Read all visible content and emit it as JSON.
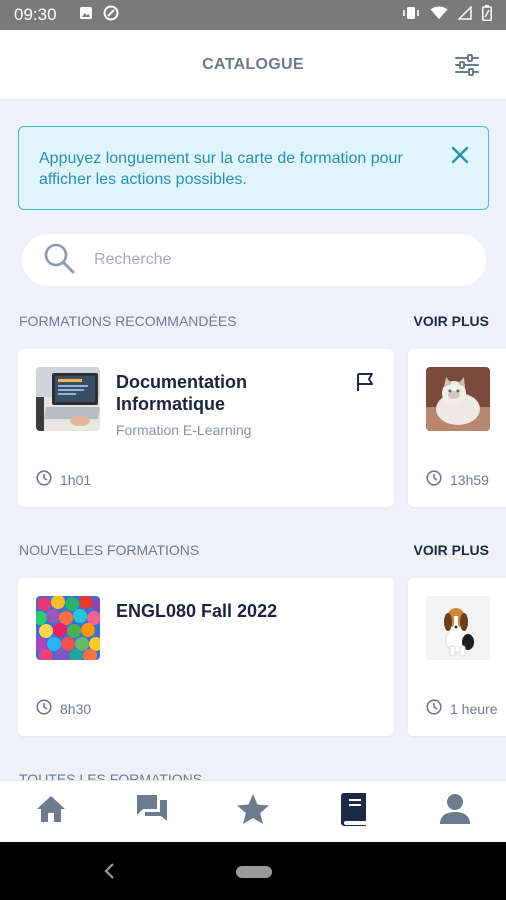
{
  "status_bar": {
    "time": "09:30"
  },
  "header": {
    "title": "CATALOGUE"
  },
  "banner": {
    "text": "Appuyez longuement sur la carte de formation pour afficher les actions possibles."
  },
  "search": {
    "placeholder": "Recherche",
    "value": ""
  },
  "sections": [
    {
      "label": "FORMATIONS RECOMMANDÉES",
      "more": "VOIR PLUS",
      "cards": [
        {
          "title": "Documentation Informatique",
          "subtitle": "Formation E-Learning",
          "duration": "1h01",
          "thumb": "laptop"
        },
        {
          "title": "",
          "subtitle": "",
          "duration": "13h59",
          "thumb": "cat"
        }
      ]
    },
    {
      "label": "NOUVELLES FORMATIONS",
      "more": "VOIR PLUS",
      "cards": [
        {
          "title": "ENGL080 Fall 2022",
          "subtitle": "",
          "duration": "8h30",
          "thumb": "balloons"
        },
        {
          "title": "",
          "subtitle": "",
          "duration": "1 heure",
          "thumb": "dog"
        }
      ]
    },
    {
      "label": "TOUTES LES FORMATIONS"
    }
  ],
  "bottom_nav": [
    {
      "icon": "home-icon",
      "active": false
    },
    {
      "icon": "chat-icon",
      "active": false
    },
    {
      "icon": "star-icon",
      "active": false
    },
    {
      "icon": "book-icon",
      "active": true
    },
    {
      "icon": "user-icon",
      "active": false
    }
  ],
  "colors": {
    "accent": "#1e2a45",
    "banner_border": "#49b9d3",
    "banner_text": "#2a8fb0",
    "nav_inactive": "#6d7b8f"
  }
}
